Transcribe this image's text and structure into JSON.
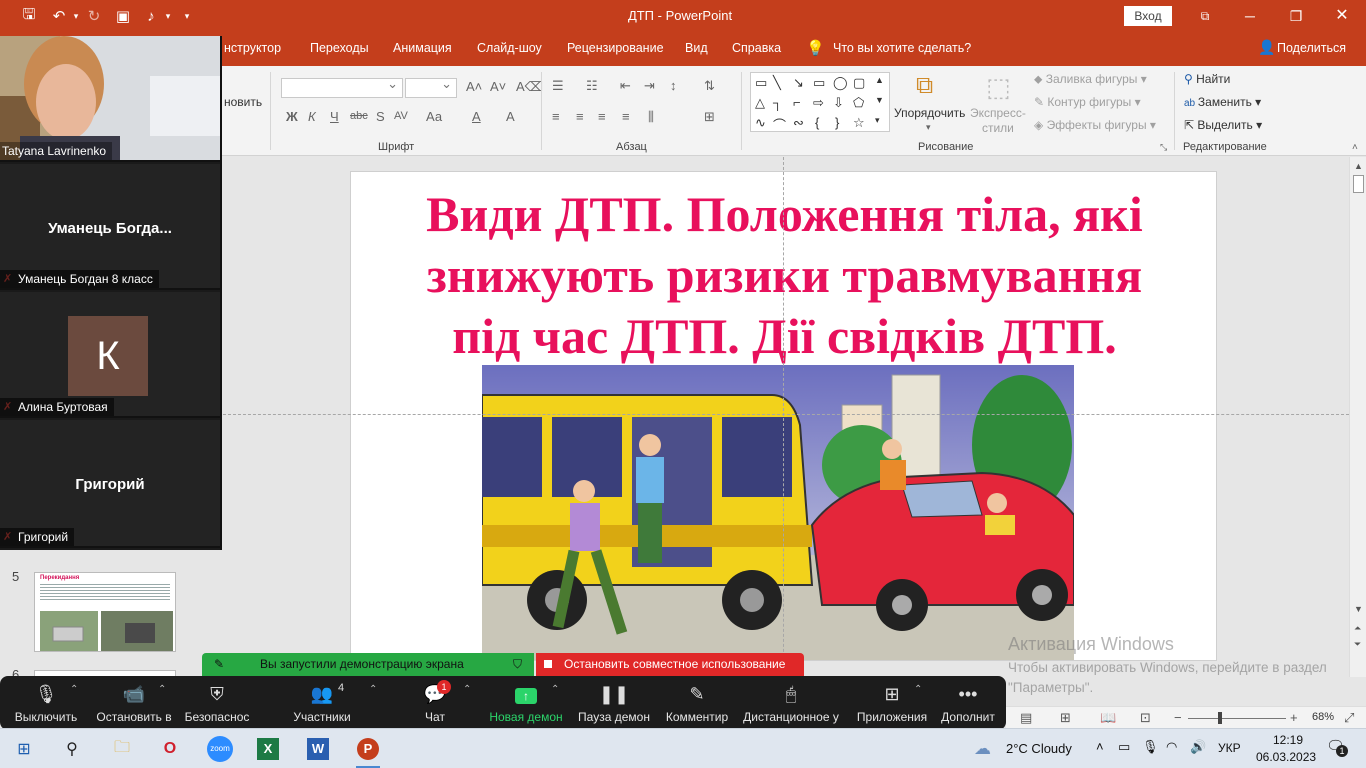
{
  "window": {
    "title": "ДТП  -  PowerPoint",
    "login_button": "Вход"
  },
  "tabs": [
    "нструктор",
    "Переходы",
    "Анимация",
    "Слайд-шоу",
    "Рецензирование",
    "Вид",
    "Справка",
    "Что вы хотите сделать?"
  ],
  "share_button": "Поделиться",
  "ribbon": {
    "partial_label": "новить",
    "groups": {
      "font": "Шрифт",
      "paragraph": "Абзац",
      "drawing": "Рисование",
      "editing": "Редактирование"
    },
    "font_buttons": [
      "Ж",
      "К",
      "Ч",
      "abc",
      "S",
      "AV",
      "Аа",
      "A",
      "A"
    ],
    "arrange": "Упорядочить",
    "quick_styles": "Экспресс-\nстили",
    "shape_fill": "Заливка фигуры",
    "shape_outline": "Контур фигуры",
    "shape_effects": "Эффекты фигуры",
    "find": "Найти",
    "replace": "Заменить",
    "select": "Выделить"
  },
  "slide": {
    "title_lines": [
      "Види ДТП. Положення тіла, які",
      "знижують ризики травмування",
      "під час ДТП. Дії свідків ДТП."
    ]
  },
  "thumbnails": {
    "numbers": [
      "5",
      "6"
    ],
    "thumb5_title": "Перекидання"
  },
  "participants": [
    {
      "name": "Tatyana Lavrinenko",
      "type": "video",
      "muted": false
    },
    {
      "name": "Уманець Богдан 8 класс",
      "display": "Уманець  Богда...",
      "type": "name",
      "muted": true
    },
    {
      "name": "Алина Буртовая",
      "initial": "К",
      "type": "avatar",
      "muted": true
    },
    {
      "name": "Григорий",
      "display": "Григорий",
      "type": "name",
      "muted": true
    }
  ],
  "share_banner": {
    "status": "Вы запустили демонстрацию экрана",
    "stop": "Остановить совместное использование"
  },
  "zoom_toolbar": [
    {
      "label": "Выключить",
      "icon": "microphone-icon"
    },
    {
      "label": "Остановить в",
      "icon": "video-camera-icon"
    },
    {
      "label": "Безопаснос",
      "icon": "shield-icon"
    },
    {
      "label": "Участники",
      "icon": "participants-icon",
      "count": "4"
    },
    {
      "label": "Чат",
      "icon": "chat-icon",
      "badge": "1"
    },
    {
      "label": "Новая демон",
      "icon": "share-screen-icon"
    },
    {
      "label": "Пауза демон",
      "icon": "pause-icon"
    },
    {
      "label": "Комментир",
      "icon": "pencil-icon"
    },
    {
      "label": "Дистанционное у",
      "icon": "mouse-icon"
    },
    {
      "label": "Приложения",
      "icon": "apps-icon"
    },
    {
      "label": "Дополнит",
      "icon": "more-icon"
    }
  ],
  "watermark": {
    "line1": "Активация Windows",
    "line2": "Чтобы активировать Windows, перейдите в раздел \"Параметры\"."
  },
  "statusbar": {
    "zoom": "68%"
  },
  "taskbar": {
    "weather": "2°C  Cloudy",
    "language": "УКР",
    "time": "12:19",
    "date": "06.03.2023",
    "notifications": "1"
  },
  "colors": {
    "ppt_accent": "#c43e1c",
    "title_pink": "#e8105c",
    "zoom_green": "#27a843",
    "zoom_red": "#e02828"
  }
}
